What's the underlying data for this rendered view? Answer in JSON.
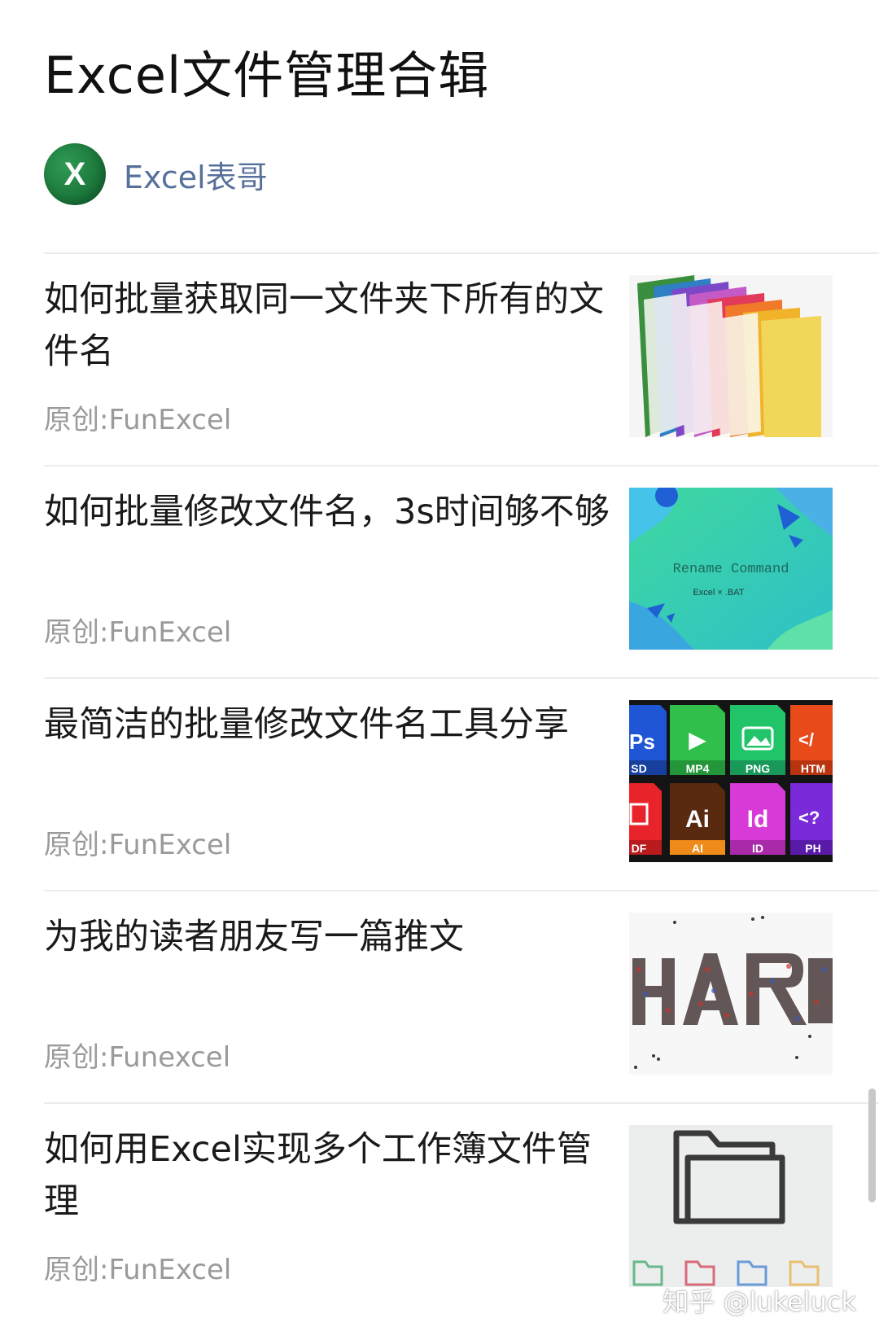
{
  "header": {
    "title": "Excel文件管理合辑"
  },
  "author": {
    "avatar_letter": "X",
    "name": "Excel表哥",
    "avatar_color": "#1d7a3d"
  },
  "articles": [
    {
      "title": "如何批量获取同一文件夹下所有的文件名",
      "meta": "原创:FunExcel",
      "thumbnail_icon": "colorful-folders-image"
    },
    {
      "title": "如何批量修改文件名，3s时间够不够",
      "meta": "原创:FunExcel",
      "thumbnail_icon": "rename-command-image",
      "thumbnail_text": "Rename  Command",
      "thumbnail_subtext": "Excel × .BAT"
    },
    {
      "title": "最简洁的批量修改文件名工具分享",
      "meta": "原创:FunExcel",
      "thumbnail_icon": "file-type-icons-image",
      "thumbnail_tiles": [
        "SD",
        "MP4",
        "PNG",
        "HTM",
        "DF",
        "AI",
        "ID",
        "PH"
      ],
      "thumbnail_tile_glyphs": [
        "Ps",
        "▶",
        "",
        "</",
        "",
        "Ai",
        "Id",
        "<?"
      ]
    },
    {
      "title": "为我的读者朋友写一篇推文",
      "meta": "原创:Funexcel",
      "thumbnail_icon": "crowd-letters-image"
    },
    {
      "title": "如何用Excel实现多个工作簿文件管理",
      "meta": "原创:FunExcel",
      "thumbnail_icon": "folder-outline-image"
    }
  ],
  "watermark": "知乎 @lukeluck",
  "colors": {
    "link": "#57709b",
    "meta": "#9a9a9a",
    "divider": "#ececec"
  }
}
